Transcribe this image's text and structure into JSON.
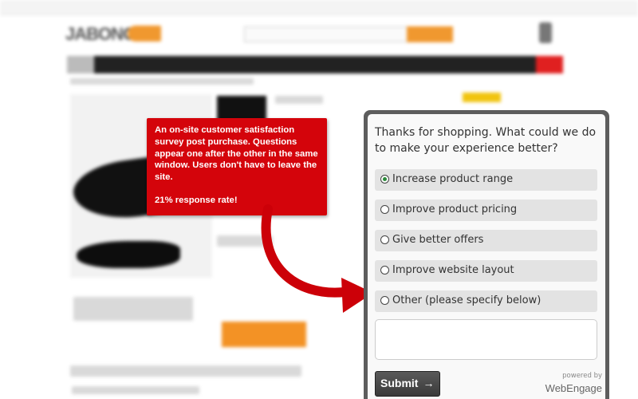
{
  "callout": {
    "description": "An on-site customer satisfaction survey post purchase. Questions appear one after the other in the same window. Users don't have to leave the site.",
    "response_rate": "21% response rate!"
  },
  "survey": {
    "question": "Thanks for shopping. What could we do to make your experience better?",
    "options": [
      {
        "label": "Increase product range",
        "selected": true
      },
      {
        "label": "Improve product pricing",
        "selected": false
      },
      {
        "label": "Give better offers",
        "selected": false
      },
      {
        "label": "Improve website layout",
        "selected": false
      },
      {
        "label": "Other (please specify below)",
        "selected": false
      }
    ],
    "comment_value": "",
    "submit_label": "Submit",
    "submit_arrow": "→",
    "powered_by": "powered by",
    "brand": "WebEngage"
  },
  "colors": {
    "callout_bg": "#d4040b",
    "arrow": "#cc0008",
    "widget_frame": "#5d5d5d",
    "option_bg": "#e3e3e3",
    "selected_radio": "#2a8a3a"
  },
  "icons": {
    "radio_selected": "radio-selected-icon",
    "radio_unselected": "radio-unselected-icon",
    "submit_arrow": "right-arrow-icon"
  }
}
